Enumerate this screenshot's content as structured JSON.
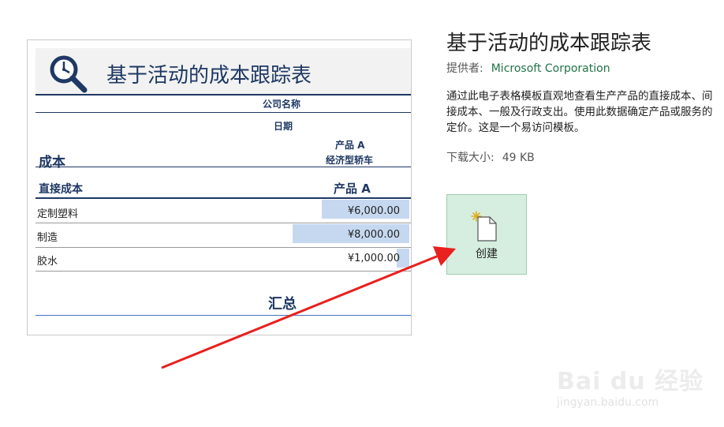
{
  "preview": {
    "title": "基于活动的成本跟踪表",
    "company_label": "公司名称",
    "date_label": "日期",
    "cost_heading": "成本",
    "product_label": "产品 A",
    "product_type": "经济型轿车",
    "direct_cost_heading": "直接成本",
    "product_col": "产品 A",
    "rows": [
      {
        "name": "定制塑料",
        "value": "¥6,000.00",
        "fill": 0.75
      },
      {
        "name": "制造",
        "value": "¥8,000.00",
        "fill": 1.0
      },
      {
        "name": "胶水",
        "value": "¥1,000.00",
        "fill": 0.11
      }
    ],
    "total_heading": "汇总"
  },
  "panel": {
    "title": "基于活动的成本跟踪表",
    "provider_label": "提供者:",
    "provider_name": "Microsoft Corporation",
    "description": "通过此电子表格模板直观地查看生产产品的直接成本、间接成本、一般及行政支出。使用此数据确定产品或服务的定价。这是一个易访问模板。",
    "size_label": "下载大小:",
    "size_value": "49 KB",
    "create_label": "创建"
  },
  "watermark": {
    "brand": "Bai du 经验",
    "url": "jingyan.baidu.com"
  },
  "colors": {
    "accent": "#1f3864",
    "bar": "#c5d8f0",
    "create_bg": "#d5eedf",
    "provider": "#217346",
    "arrow": "#e8201e"
  },
  "icons": {
    "preview_logo": "magnifier-clock-icon",
    "create": "new-document-icon"
  }
}
